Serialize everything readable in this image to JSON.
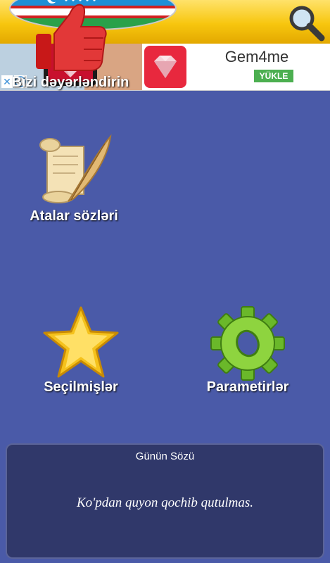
{
  "header": {
    "search_icon": "search-icon",
    "flag_icon": "flag-heart-icon"
  },
  "ad": {
    "title": "Gem4me",
    "cta": "YÜKLE",
    "close_icon": "close-icon",
    "info_icon": "info-icon",
    "app_icon": "diamond-icon",
    "accent": "#e8283e"
  },
  "menu": {
    "items": [
      {
        "label": "Atalar sözləri",
        "icon": "scroll-quill-icon"
      },
      {
        "label": "Bizi dəyərləndirin",
        "icon": "thumbs-up-icon"
      },
      {
        "label": "Seçilmişlər",
        "icon": "star-icon"
      },
      {
        "label": "Parametirlər",
        "icon": "gear-icon"
      }
    ]
  },
  "daily": {
    "title": "Günün Sözü",
    "text": "Ko'pdan quyon qochib qutulmas."
  }
}
